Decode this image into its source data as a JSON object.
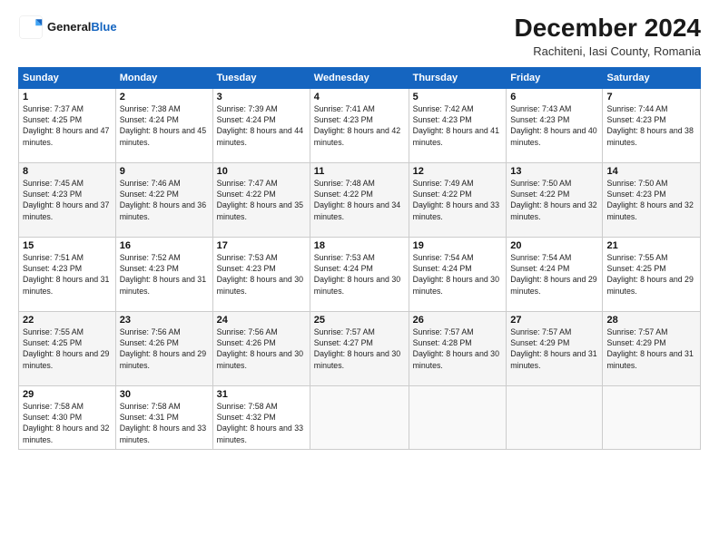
{
  "header": {
    "logo_line1": "General",
    "logo_line2": "Blue",
    "month_title": "December 2024",
    "subtitle": "Rachiteni, Iasi County, Romania"
  },
  "weekdays": [
    "Sunday",
    "Monday",
    "Tuesday",
    "Wednesday",
    "Thursday",
    "Friday",
    "Saturday"
  ],
  "weeks": [
    [
      {
        "day": "1",
        "sunrise": "7:37 AM",
        "sunset": "4:25 PM",
        "daylight": "8 hours and 47 minutes."
      },
      {
        "day": "2",
        "sunrise": "7:38 AM",
        "sunset": "4:24 PM",
        "daylight": "8 hours and 45 minutes."
      },
      {
        "day": "3",
        "sunrise": "7:39 AM",
        "sunset": "4:24 PM",
        "daylight": "8 hours and 44 minutes."
      },
      {
        "day": "4",
        "sunrise": "7:41 AM",
        "sunset": "4:23 PM",
        "daylight": "8 hours and 42 minutes."
      },
      {
        "day": "5",
        "sunrise": "7:42 AM",
        "sunset": "4:23 PM",
        "daylight": "8 hours and 41 minutes."
      },
      {
        "day": "6",
        "sunrise": "7:43 AM",
        "sunset": "4:23 PM",
        "daylight": "8 hours and 40 minutes."
      },
      {
        "day": "7",
        "sunrise": "7:44 AM",
        "sunset": "4:23 PM",
        "daylight": "8 hours and 38 minutes."
      }
    ],
    [
      {
        "day": "8",
        "sunrise": "7:45 AM",
        "sunset": "4:23 PM",
        "daylight": "8 hours and 37 minutes."
      },
      {
        "day": "9",
        "sunrise": "7:46 AM",
        "sunset": "4:22 PM",
        "daylight": "8 hours and 36 minutes."
      },
      {
        "day": "10",
        "sunrise": "7:47 AM",
        "sunset": "4:22 PM",
        "daylight": "8 hours and 35 minutes."
      },
      {
        "day": "11",
        "sunrise": "7:48 AM",
        "sunset": "4:22 PM",
        "daylight": "8 hours and 34 minutes."
      },
      {
        "day": "12",
        "sunrise": "7:49 AM",
        "sunset": "4:22 PM",
        "daylight": "8 hours and 33 minutes."
      },
      {
        "day": "13",
        "sunrise": "7:50 AM",
        "sunset": "4:22 PM",
        "daylight": "8 hours and 32 minutes."
      },
      {
        "day": "14",
        "sunrise": "7:50 AM",
        "sunset": "4:23 PM",
        "daylight": "8 hours and 32 minutes."
      }
    ],
    [
      {
        "day": "15",
        "sunrise": "7:51 AM",
        "sunset": "4:23 PM",
        "daylight": "8 hours and 31 minutes."
      },
      {
        "day": "16",
        "sunrise": "7:52 AM",
        "sunset": "4:23 PM",
        "daylight": "8 hours and 31 minutes."
      },
      {
        "day": "17",
        "sunrise": "7:53 AM",
        "sunset": "4:23 PM",
        "daylight": "8 hours and 30 minutes."
      },
      {
        "day": "18",
        "sunrise": "7:53 AM",
        "sunset": "4:24 PM",
        "daylight": "8 hours and 30 minutes."
      },
      {
        "day": "19",
        "sunrise": "7:54 AM",
        "sunset": "4:24 PM",
        "daylight": "8 hours and 30 minutes."
      },
      {
        "day": "20",
        "sunrise": "7:54 AM",
        "sunset": "4:24 PM",
        "daylight": "8 hours and 29 minutes."
      },
      {
        "day": "21",
        "sunrise": "7:55 AM",
        "sunset": "4:25 PM",
        "daylight": "8 hours and 29 minutes."
      }
    ],
    [
      {
        "day": "22",
        "sunrise": "7:55 AM",
        "sunset": "4:25 PM",
        "daylight": "8 hours and 29 minutes."
      },
      {
        "day": "23",
        "sunrise": "7:56 AM",
        "sunset": "4:26 PM",
        "daylight": "8 hours and 29 minutes."
      },
      {
        "day": "24",
        "sunrise": "7:56 AM",
        "sunset": "4:26 PM",
        "daylight": "8 hours and 30 minutes."
      },
      {
        "day": "25",
        "sunrise": "7:57 AM",
        "sunset": "4:27 PM",
        "daylight": "8 hours and 30 minutes."
      },
      {
        "day": "26",
        "sunrise": "7:57 AM",
        "sunset": "4:28 PM",
        "daylight": "8 hours and 30 minutes."
      },
      {
        "day": "27",
        "sunrise": "7:57 AM",
        "sunset": "4:29 PM",
        "daylight": "8 hours and 31 minutes."
      },
      {
        "day": "28",
        "sunrise": "7:57 AM",
        "sunset": "4:29 PM",
        "daylight": "8 hours and 31 minutes."
      }
    ],
    [
      {
        "day": "29",
        "sunrise": "7:58 AM",
        "sunset": "4:30 PM",
        "daylight": "8 hours and 32 minutes."
      },
      {
        "day": "30",
        "sunrise": "7:58 AM",
        "sunset": "4:31 PM",
        "daylight": "8 hours and 33 minutes."
      },
      {
        "day": "31",
        "sunrise": "7:58 AM",
        "sunset": "4:32 PM",
        "daylight": "8 hours and 33 minutes."
      },
      null,
      null,
      null,
      null
    ]
  ]
}
